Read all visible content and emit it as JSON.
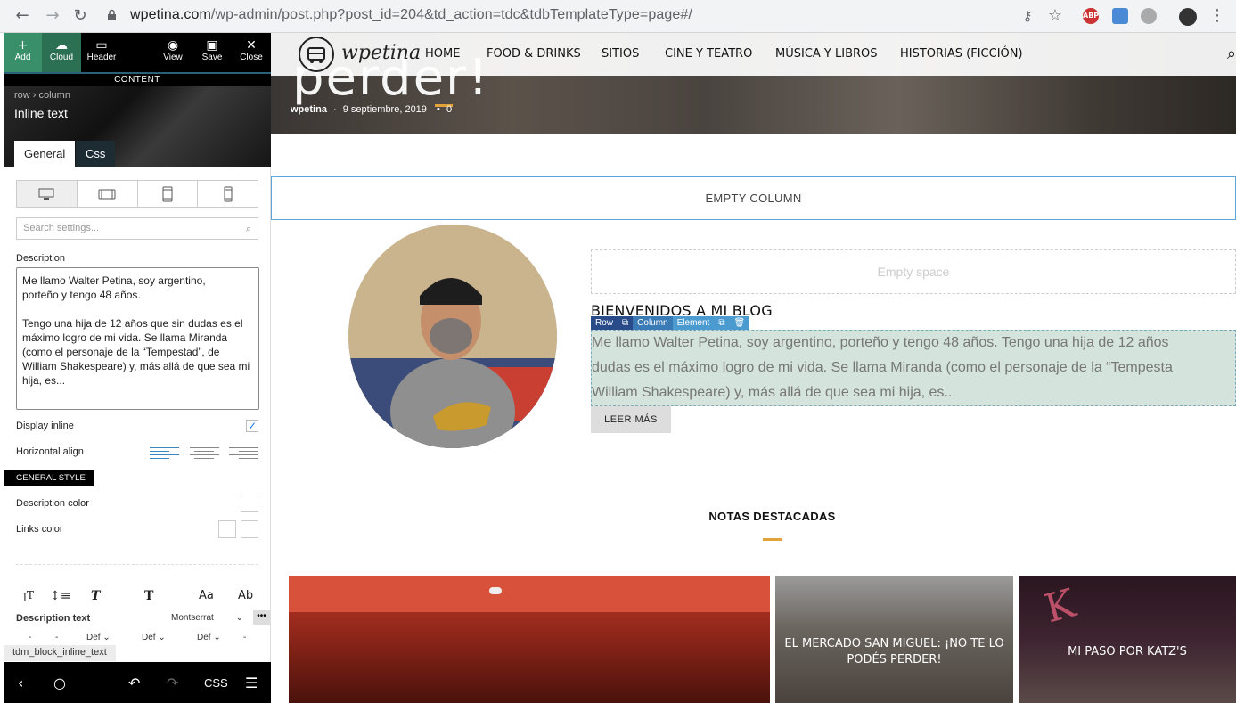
{
  "browser": {
    "url_host": "wpetina.com",
    "url_path": "/wp-admin/post.php?post_id=204&td_action=tdc&tdbTemplateType=page#/",
    "ext_abp": "ABP"
  },
  "editor": {
    "toolbar": {
      "add": "Add",
      "cloud": "Cloud",
      "header": "Header",
      "view": "View",
      "save": "Save",
      "close": "Close"
    },
    "content_label": "CONTENT",
    "breadcrumb": "row › column",
    "title": "Inline text",
    "tabs": {
      "general": "General",
      "css": "Css"
    },
    "search_placeholder": "Search settings...",
    "description_label": "Description",
    "description_value": "Me llamo Walter Petina, soy argentino,\nporteño y tengo 48 años.\n\nTengo una hija de 12 años que sin dudas es el máximo logro de mi vida. Se llama Miranda (como el personaje de la “Tempestad”, de William Shakespeare) y, más allá de que sea mi hija, es...",
    "display_inline_label": "Display inline",
    "display_inline_checked": true,
    "horizontal_align_label": "Horizontal align",
    "general_style_label": "GENERAL STYLE",
    "description_color_label": "Description color",
    "links_color_label": "Links color",
    "description_text_label": "Description text",
    "font_value": "Montserrat",
    "def1": "Def",
    "def2": "Def",
    "def3": "Def",
    "dash1": "-",
    "dash2": "-",
    "dash3": "-",
    "block_tag": "tdm_block_inline_text",
    "bottom_css": "CSS"
  },
  "site": {
    "logo_text": "wpetina",
    "nav": [
      "HOME",
      "FOOD & DRINKS",
      "SITIOS",
      "CINE Y TEATRO",
      "MÚSICA Y LIBROS",
      "HISTORIAS (FICCIÓN)"
    ],
    "hero_title": "perder!",
    "meta_author": "wpetina",
    "meta_sep": "·",
    "meta_date": "9 septiembre, 2019",
    "meta_comments": "0",
    "empty_column": "EMPTY COLUMN",
    "empty_space": "Empty space",
    "welcome_title": "BIENVENIDOS A MI BLOG",
    "badges": {
      "row": "Row",
      "column": "Column",
      "element": "Element"
    },
    "blog_lines": [
      "Me llamo Walter Petina, soy argentino, porteño y tengo 48 años. Tengo una hija de 12 años",
      "dudas es el máximo logro de mi vida. Se llama Miranda (como el personaje de la “Tempesta",
      "William Shakespeare) y, más allá de que sea mi hija, es..."
    ],
    "read_more": "LEER MÁS",
    "featured_title": "NOTAS DESTACADAS",
    "cards": [
      {
        "title": ""
      },
      {
        "title": "EL MERCADO SAN MIGUEL: ¡NO TE LO PODÉS PERDER!"
      },
      {
        "title": "MI PASO POR KATZ'S"
      }
    ]
  }
}
